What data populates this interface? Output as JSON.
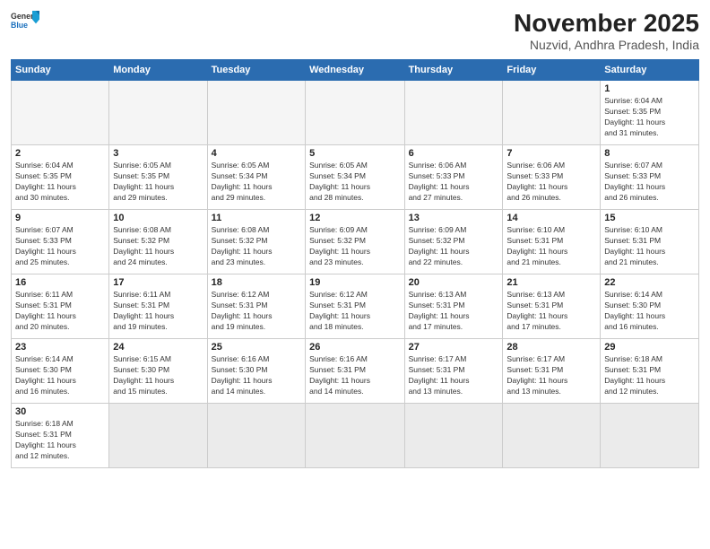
{
  "header": {
    "logo_general": "General",
    "logo_blue": "Blue",
    "title": "November 2025",
    "subtitle": "Nuzvid, Andhra Pradesh, India"
  },
  "weekdays": [
    "Sunday",
    "Monday",
    "Tuesday",
    "Wednesday",
    "Thursday",
    "Friday",
    "Saturday"
  ],
  "weeks": [
    [
      {
        "day": "",
        "info": "",
        "empty": true
      },
      {
        "day": "",
        "info": "",
        "empty": true
      },
      {
        "day": "",
        "info": "",
        "empty": true
      },
      {
        "day": "",
        "info": "",
        "empty": true
      },
      {
        "day": "",
        "info": "",
        "empty": true
      },
      {
        "day": "",
        "info": "",
        "empty": true
      },
      {
        "day": "1",
        "info": "Sunrise: 6:04 AM\nSunset: 5:35 PM\nDaylight: 11 hours\nand 31 minutes."
      }
    ],
    [
      {
        "day": "2",
        "info": "Sunrise: 6:04 AM\nSunset: 5:35 PM\nDaylight: 11 hours\nand 30 minutes."
      },
      {
        "day": "3",
        "info": "Sunrise: 6:05 AM\nSunset: 5:35 PM\nDaylight: 11 hours\nand 29 minutes."
      },
      {
        "day": "4",
        "info": "Sunrise: 6:05 AM\nSunset: 5:34 PM\nDaylight: 11 hours\nand 29 minutes."
      },
      {
        "day": "5",
        "info": "Sunrise: 6:05 AM\nSunset: 5:34 PM\nDaylight: 11 hours\nand 28 minutes."
      },
      {
        "day": "6",
        "info": "Sunrise: 6:06 AM\nSunset: 5:33 PM\nDaylight: 11 hours\nand 27 minutes."
      },
      {
        "day": "7",
        "info": "Sunrise: 6:06 AM\nSunset: 5:33 PM\nDaylight: 11 hours\nand 26 minutes."
      },
      {
        "day": "8",
        "info": "Sunrise: 6:07 AM\nSunset: 5:33 PM\nDaylight: 11 hours\nand 26 minutes."
      }
    ],
    [
      {
        "day": "9",
        "info": "Sunrise: 6:07 AM\nSunset: 5:33 PM\nDaylight: 11 hours\nand 25 minutes."
      },
      {
        "day": "10",
        "info": "Sunrise: 6:08 AM\nSunset: 5:32 PM\nDaylight: 11 hours\nand 24 minutes."
      },
      {
        "day": "11",
        "info": "Sunrise: 6:08 AM\nSunset: 5:32 PM\nDaylight: 11 hours\nand 23 minutes."
      },
      {
        "day": "12",
        "info": "Sunrise: 6:09 AM\nSunset: 5:32 PM\nDaylight: 11 hours\nand 23 minutes."
      },
      {
        "day": "13",
        "info": "Sunrise: 6:09 AM\nSunset: 5:32 PM\nDaylight: 11 hours\nand 22 minutes."
      },
      {
        "day": "14",
        "info": "Sunrise: 6:10 AM\nSunset: 5:31 PM\nDaylight: 11 hours\nand 21 minutes."
      },
      {
        "day": "15",
        "info": "Sunrise: 6:10 AM\nSunset: 5:31 PM\nDaylight: 11 hours\nand 21 minutes."
      }
    ],
    [
      {
        "day": "16",
        "info": "Sunrise: 6:11 AM\nSunset: 5:31 PM\nDaylight: 11 hours\nand 20 minutes."
      },
      {
        "day": "17",
        "info": "Sunrise: 6:11 AM\nSunset: 5:31 PM\nDaylight: 11 hours\nand 19 minutes."
      },
      {
        "day": "18",
        "info": "Sunrise: 6:12 AM\nSunset: 5:31 PM\nDaylight: 11 hours\nand 19 minutes."
      },
      {
        "day": "19",
        "info": "Sunrise: 6:12 AM\nSunset: 5:31 PM\nDaylight: 11 hours\nand 18 minutes."
      },
      {
        "day": "20",
        "info": "Sunrise: 6:13 AM\nSunset: 5:31 PM\nDaylight: 11 hours\nand 17 minutes."
      },
      {
        "day": "21",
        "info": "Sunrise: 6:13 AM\nSunset: 5:31 PM\nDaylight: 11 hours\nand 17 minutes."
      },
      {
        "day": "22",
        "info": "Sunrise: 6:14 AM\nSunset: 5:30 PM\nDaylight: 11 hours\nand 16 minutes."
      }
    ],
    [
      {
        "day": "23",
        "info": "Sunrise: 6:14 AM\nSunset: 5:30 PM\nDaylight: 11 hours\nand 16 minutes."
      },
      {
        "day": "24",
        "info": "Sunrise: 6:15 AM\nSunset: 5:30 PM\nDaylight: 11 hours\nand 15 minutes."
      },
      {
        "day": "25",
        "info": "Sunrise: 6:16 AM\nSunset: 5:30 PM\nDaylight: 11 hours\nand 14 minutes."
      },
      {
        "day": "26",
        "info": "Sunrise: 6:16 AM\nSunset: 5:31 PM\nDaylight: 11 hours\nand 14 minutes."
      },
      {
        "day": "27",
        "info": "Sunrise: 6:17 AM\nSunset: 5:31 PM\nDaylight: 11 hours\nand 13 minutes."
      },
      {
        "day": "28",
        "info": "Sunrise: 6:17 AM\nSunset: 5:31 PM\nDaylight: 11 hours\nand 13 minutes."
      },
      {
        "day": "29",
        "info": "Sunrise: 6:18 AM\nSunset: 5:31 PM\nDaylight: 11 hours\nand 12 minutes."
      }
    ],
    [
      {
        "day": "30",
        "info": "Sunrise: 6:18 AM\nSunset: 5:31 PM\nDaylight: 11 hours\nand 12 minutes."
      },
      {
        "day": "",
        "info": "",
        "empty": true
      },
      {
        "day": "",
        "info": "",
        "empty": true
      },
      {
        "day": "",
        "info": "",
        "empty": true
      },
      {
        "day": "",
        "info": "",
        "empty": true
      },
      {
        "day": "",
        "info": "",
        "empty": true
      },
      {
        "day": "",
        "info": "",
        "empty": true
      }
    ]
  ]
}
